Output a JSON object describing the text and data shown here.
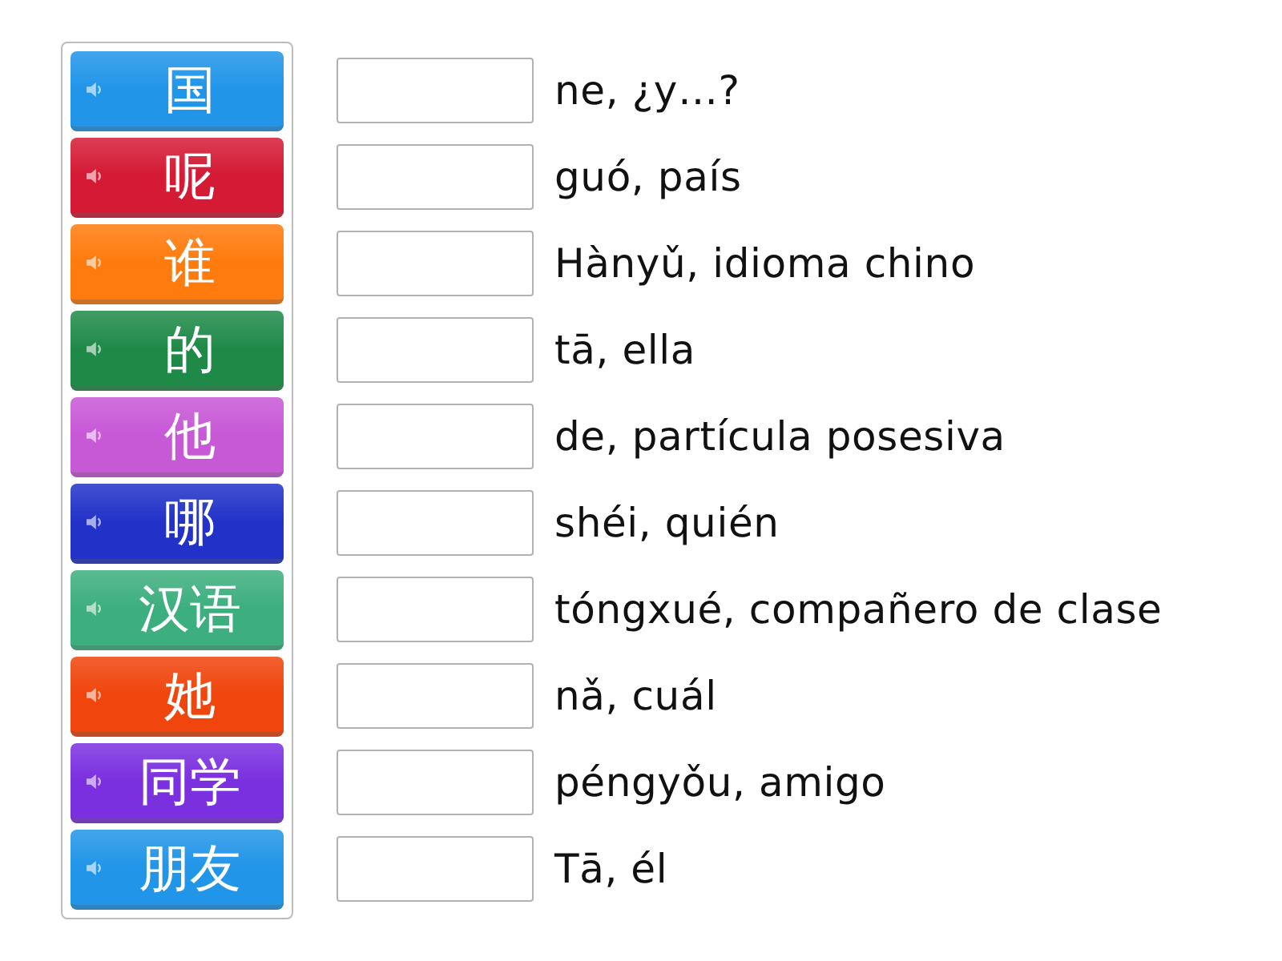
{
  "tiles": [
    {
      "text": "国",
      "color": "#2195e8"
    },
    {
      "text": "呢",
      "color": "#d41a35"
    },
    {
      "text": "谁",
      "color": "#ff7b0d"
    },
    {
      "text": "的",
      "color": "#1f8a48"
    },
    {
      "text": "他",
      "color": "#c758d6"
    },
    {
      "text": "哪",
      "color": "#2232c8"
    },
    {
      "text": "汉语",
      "color": "#3daf7e"
    },
    {
      "text": "她",
      "color": "#f0450c"
    },
    {
      "text": "同学",
      "color": "#7b30e0"
    },
    {
      "text": "朋友",
      "color": "#2195e8"
    }
  ],
  "answers": [
    {
      "text": "ne, ¿y…?"
    },
    {
      "text": "guó, país"
    },
    {
      "text": "Hànyǔ, idioma chino"
    },
    {
      "text": "tā, ella"
    },
    {
      "text": "de, partícula posesiva"
    },
    {
      "text": "shéi, quién"
    },
    {
      "text": "tóngxué, compañero de clase"
    },
    {
      "text": "nǎ, cuál"
    },
    {
      "text": "péngyǒu, amigo"
    },
    {
      "text": "Tā, él"
    }
  ]
}
